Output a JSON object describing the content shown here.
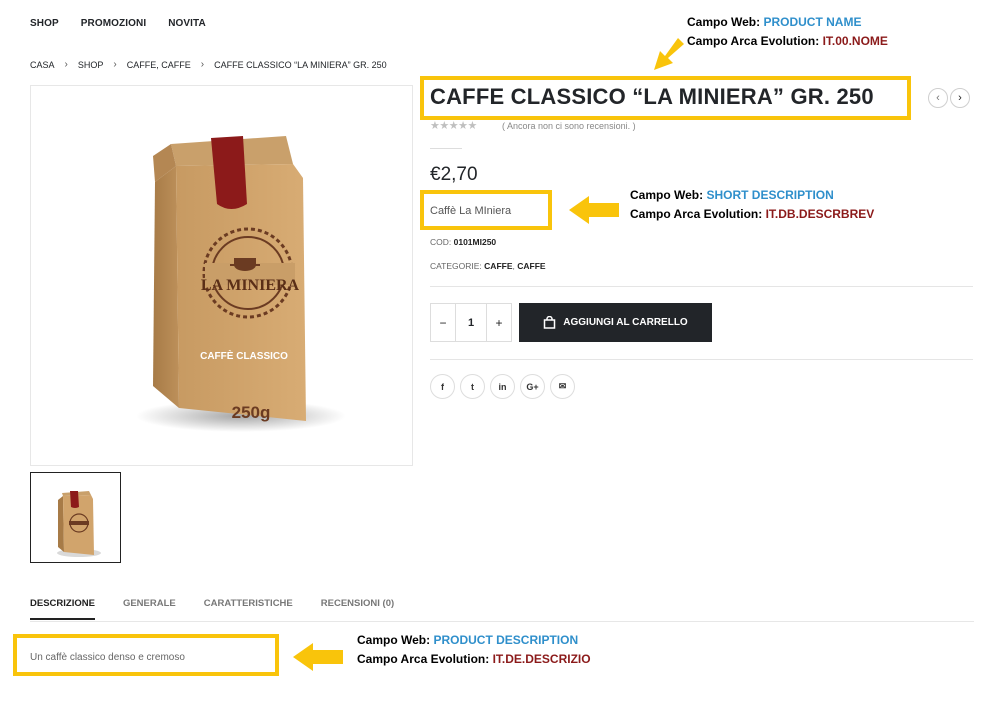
{
  "nav": {
    "items": [
      "SHOP",
      "PROMOZIONI",
      "NOVITA"
    ]
  },
  "breadcrumb": {
    "home": "CASA",
    "shop": "SHOP",
    "category": "CAFFE, CAFFE",
    "current": "CAFFE CLASSICO “LA MINIERA” GR. 250"
  },
  "product": {
    "title": "CAFFE CLASSICO “LA MINIERA” GR. 250",
    "reviews_note": "( Ancora non ci sono recensioni. )",
    "price": "€2,70",
    "short_description": "Caffè La MIniera",
    "cod_label": "COD:",
    "cod_value": "0101MI250",
    "categories_label": "CATEGORIE:",
    "categories": [
      "CAFFE",
      "CAFFE"
    ],
    "categories_sep": ",",
    "quantity": "1",
    "add_to_cart": "AGGIUNGI AL CARRELLO",
    "image_texts": {
      "brand": "LA MINIERA",
      "variant": "CAFFÈ CLASSICO",
      "weight": "250g"
    },
    "rating": 0
  },
  "social": {
    "icons": [
      "facebook-icon",
      "twitter-icon",
      "linkedin-icon",
      "google-plus-icon",
      "email-icon"
    ],
    "labels": [
      "f",
      "t",
      "in",
      "G+",
      "✉"
    ]
  },
  "tabs": [
    "DESCRIZIONE",
    "GENERALE",
    "CARATTERISTICHE",
    "RECENSIONI (0)"
  ],
  "description": "Un caffè classico denso e cremoso",
  "annotations": {
    "title": {
      "web_label": "Campo Web:",
      "web_value": "PRODUCT NAME",
      "arca_label": "Campo Arca Evolution:",
      "arca_value": "IT.00.NOME"
    },
    "short": {
      "web_label": "Campo Web:",
      "web_value": "SHORT DESCRIPTION",
      "arca_label": "Campo Arca Evolution:",
      "arca_value": "IT.DB.DESCRBREV"
    },
    "description": {
      "web_label": "Campo Web:",
      "web_value": "PRODUCT DESCRIPTION",
      "arca_label": "Campo Arca Evolution:",
      "arca_value": "IT.DE.DESCRIZIO"
    }
  },
  "colors": {
    "highlight": "#f9c40b",
    "annotation_blue": "#2f8fcb",
    "annotation_red": "#8b1a1a",
    "dark": "#222529"
  }
}
